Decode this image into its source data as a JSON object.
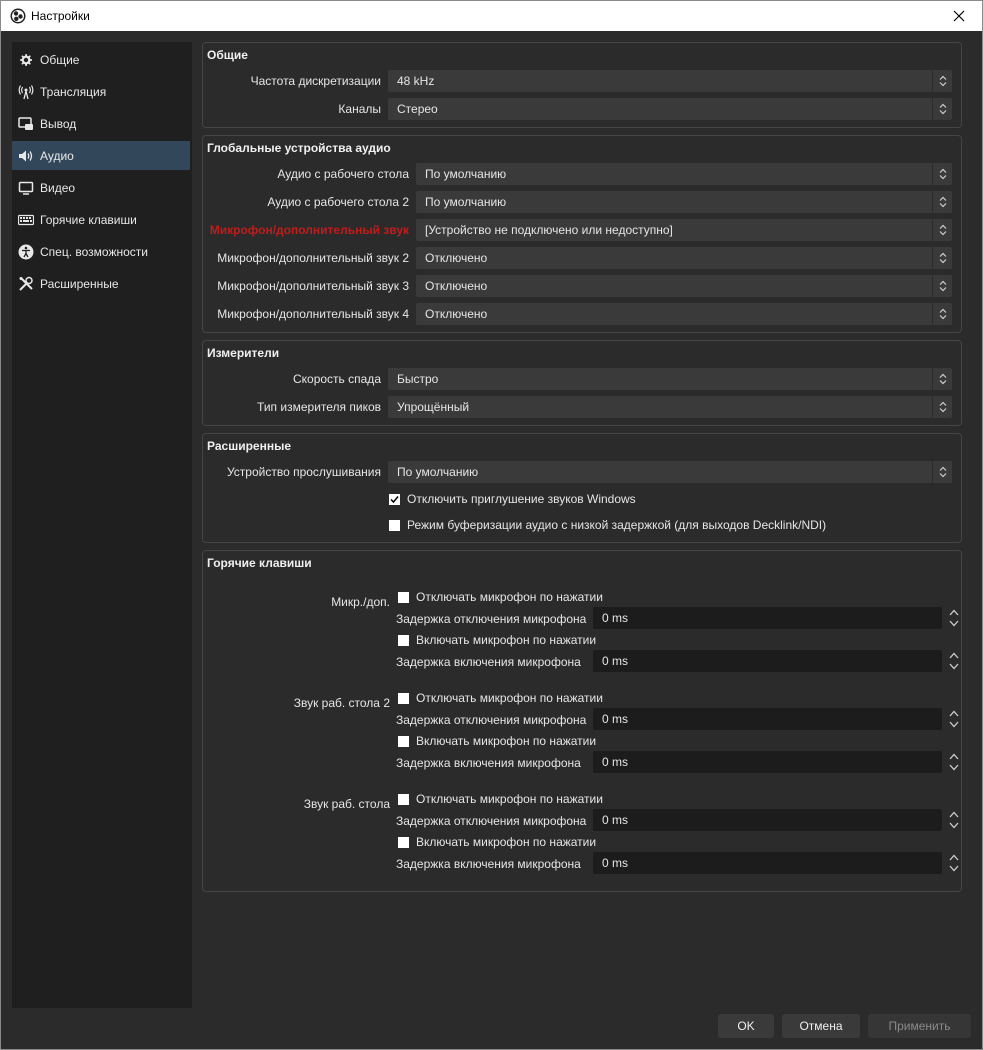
{
  "window": {
    "title": "Настройки"
  },
  "sidebar": {
    "items": [
      {
        "label": "Общие",
        "icon": "gear-icon"
      },
      {
        "label": "Трансляция",
        "icon": "broadcast-icon"
      },
      {
        "label": "Вывод",
        "icon": "output-icon"
      },
      {
        "label": "Аудио",
        "icon": "speaker-icon",
        "active": true
      },
      {
        "label": "Видео",
        "icon": "monitor-icon"
      },
      {
        "label": "Горячие клавиши",
        "icon": "keyboard-icon"
      },
      {
        "label": "Спец. возможности",
        "icon": "accessibility-icon"
      },
      {
        "label": "Расширенные",
        "icon": "tools-icon"
      }
    ]
  },
  "general": {
    "title": "Общие",
    "sample_rate_label": "Частота дискретизации",
    "sample_rate_value": "48 kHz",
    "channels_label": "Каналы",
    "channels_value": "Стерео"
  },
  "global_audio": {
    "title": "Глобальные устройства аудио",
    "rows": [
      {
        "label": "Аудио с рабочего стола",
        "value": "По умолчанию"
      },
      {
        "label": "Аудио с рабочего стола 2",
        "value": "По умолчанию"
      },
      {
        "label": "Микрофон/дополнительный звук",
        "value": "[Устройство не подключено или недоступно]",
        "error": true
      },
      {
        "label": "Микрофон/дополнительный звук 2",
        "value": "Отключено"
      },
      {
        "label": "Микрофон/дополнительный звук 3",
        "value": "Отключено"
      },
      {
        "label": "Микрофон/дополнительный звук 4",
        "value": "Отключено"
      }
    ]
  },
  "meters": {
    "title": "Измерители",
    "decay_label": "Скорость спада",
    "decay_value": "Быстро",
    "peak_label": "Тип измерителя пиков",
    "peak_value": "Упрощённый"
  },
  "advanced": {
    "title": "Расширенные",
    "monitoring_label": "Устройство прослушивания",
    "monitoring_value": "По умолчанию",
    "disable_ducking_label": "Отключить приглушение звуков Windows",
    "disable_ducking_checked": true,
    "low_latency_label": "Режим буферизации аудио с низкой задержкой (для выходов Decklink/NDI)",
    "low_latency_checked": false
  },
  "hotkeys": {
    "title": "Горячие клавиши",
    "sources": [
      {
        "name": "Микр./доп.",
        "ptm_label": "Отключать микрофон по нажатии",
        "ptm_delay_label": "Задержка отключения микрофона",
        "ptm_delay_value": "0 ms",
        "ptt_label": "Включать микрофон по нажатии",
        "ptt_delay_label": "Задержка включения микрофона",
        "ptt_delay_value": "0 ms"
      },
      {
        "name": "Звук раб. стола 2",
        "ptm_label": "Отключать микрофон по нажатии",
        "ptm_delay_label": "Задержка отключения микрофона",
        "ptm_delay_value": "0 ms",
        "ptt_label": "Включать микрофон по нажатии",
        "ptt_delay_label": "Задержка включения микрофона",
        "ptt_delay_value": "0 ms"
      },
      {
        "name": "Звук раб. стола",
        "ptm_label": "Отключать микрофон по нажатии",
        "ptm_delay_label": "Задержка отключения микрофона",
        "ptm_delay_value": "0 ms",
        "ptt_label": "Включать микрофон по нажатии",
        "ptt_delay_label": "Задержка включения микрофона",
        "ptt_delay_value": "0 ms"
      }
    ]
  },
  "buttons": {
    "ok": "OK",
    "cancel": "Отмена",
    "apply": "Применить"
  },
  "colors": {
    "background": "#2b2b2b",
    "sidebar": "#1f1f1f",
    "active_item": "#33475b",
    "error_label": "#c01c1c"
  }
}
